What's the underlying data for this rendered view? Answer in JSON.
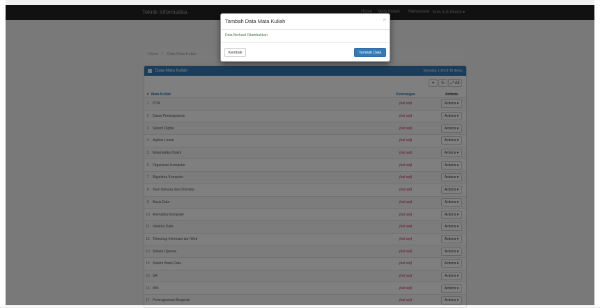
{
  "navbar": {
    "brand": "Teknik Informatika",
    "items": [
      "Home",
      "Mata Kuliah",
      "Mahasiswa",
      "Kuis & E-Modul ▾"
    ]
  },
  "breadcrumb": {
    "home": "Home",
    "separator": "/",
    "current": "Data Mata Kuliah"
  },
  "panel": {
    "title": "Data Mata Kuliah",
    "showing": "Showing 1-20 of 30 items."
  },
  "toolbar": {
    "add": "+",
    "refresh": "↻",
    "all": "⤢ All"
  },
  "table": {
    "headers": [
      "#",
      "Mata Kuliah",
      "Keterangan",
      "Actions"
    ],
    "rows": [
      {
        "no": "1",
        "name": "PTIK",
        "ket": "(not set)",
        "action": "Actions ▾"
      },
      {
        "no": "2",
        "name": "Dasar Pemrograman",
        "ket": "(not set)",
        "action": "Actions ▾"
      },
      {
        "no": "3",
        "name": "Sistem Digital",
        "ket": "(not set)",
        "action": "Actions ▾"
      },
      {
        "no": "4",
        "name": "Aljabar Linear",
        "ket": "(not set)",
        "action": "Actions ▾"
      },
      {
        "no": "5",
        "name": "Matematika Diskrit",
        "ket": "(not set)",
        "action": "Actions ▾"
      },
      {
        "no": "6",
        "name": "Organisasi Komputer",
        "ket": "(not set)",
        "action": "Actions ▾"
      },
      {
        "no": "7",
        "name": "Algoritma Komputer",
        "ket": "(not set)",
        "action": "Actions ▾"
      },
      {
        "no": "8",
        "name": "Teori Bahasa dan Otomata",
        "ket": "(not set)",
        "action": "Actions ▾"
      },
      {
        "no": "9",
        "name": "Basis Data",
        "ket": "(not set)",
        "action": "Actions ▾"
      },
      {
        "no": "10",
        "name": "Animatika Komputer",
        "ket": "(not set)",
        "action": "Actions ▾"
      },
      {
        "no": "11",
        "name": "Struktur Data",
        "ket": "(not set)",
        "action": "Actions ▾"
      },
      {
        "no": "12",
        "name": "Teknologi Informasi dan Web",
        "ket": "(not set)",
        "action": "Actions ▾"
      },
      {
        "no": "13",
        "name": "Sistem Operasi",
        "ket": "(not set)",
        "action": "Actions ▾"
      },
      {
        "no": "14",
        "name": "Sistem Basis Data",
        "ket": "(not set)",
        "action": "Actions ▾"
      },
      {
        "no": "15",
        "name": "SA",
        "ket": "(not set)",
        "action": "Actions ▾"
      },
      {
        "no": "16",
        "name": "IMK",
        "ket": "(not set)",
        "action": "Actions ▾"
      },
      {
        "no": "17",
        "name": "Pemrograman Bergerak",
        "ket": "(not set)",
        "action": "Actions ▾"
      }
    ]
  },
  "modal": {
    "title": "Tambah Data Mata Kuliah",
    "close": "×",
    "message": "Data Berhasil Ditambahkan",
    "back_label": "Kembali",
    "add_label": "Tambah Data"
  },
  "colors": {
    "navbar": "#222222",
    "primary": "#337ab7",
    "not_set": "#c7254e",
    "success_text": "#3c763d"
  }
}
